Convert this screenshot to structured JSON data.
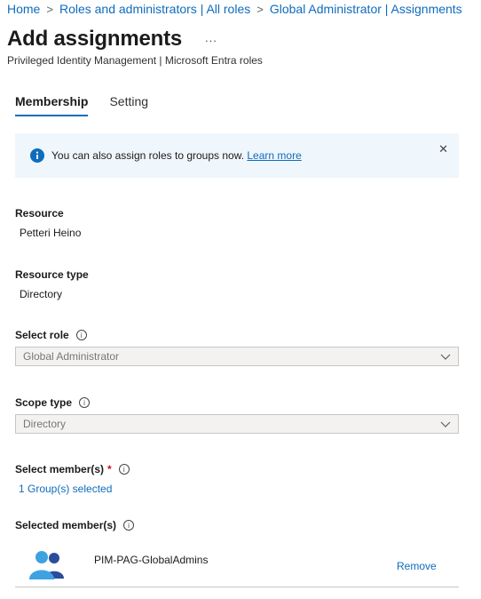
{
  "breadcrumb": {
    "items": [
      "Home",
      "Roles and administrators | All roles",
      "Global Administrator | Assignments"
    ],
    "separator": ">"
  },
  "header": {
    "title": "Add assignments",
    "more": "...",
    "subtitle": "Privileged Identity Management | Microsoft Entra roles"
  },
  "tabs": [
    {
      "label": "Membership",
      "active": true
    },
    {
      "label": "Setting",
      "active": false
    }
  ],
  "banner": {
    "text": "You can also assign roles to groups now.",
    "link": "Learn more",
    "close": "✕",
    "icon": "info-icon"
  },
  "form": {
    "resource_label": "Resource",
    "resource_value": "Petteri Heino",
    "resource_type_label": "Resource type",
    "resource_type_value": "Directory",
    "select_role_label": "Select role",
    "select_role_value": "Global Administrator",
    "scope_type_label": "Scope type",
    "scope_type_value": "Directory",
    "select_members_label": "Select member(s)",
    "required_mark": "*",
    "select_members_link": "1 Group(s) selected",
    "selected_members_label": "Selected member(s)",
    "info_glyph": "i"
  },
  "members": [
    {
      "name": "PIM-PAG-GlobalAdmins",
      "action": "Remove",
      "icon": "group-icon"
    }
  ],
  "colors": {
    "accent": "#0f6cbd",
    "banner_bg": "#eff6fc",
    "required": "#c50f1f",
    "disabled_bg": "#f3f2f1"
  }
}
